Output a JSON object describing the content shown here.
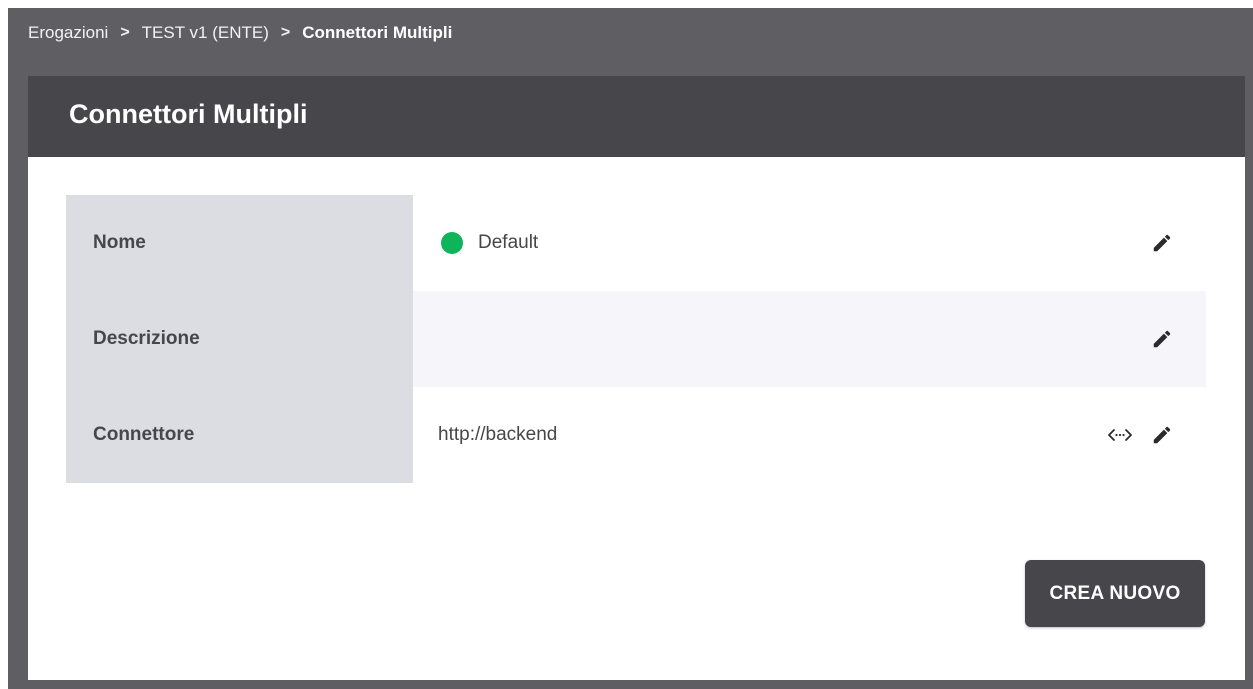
{
  "breadcrumb": {
    "items": [
      "Erogazioni",
      "TEST v1 (ENTE)"
    ],
    "current": "Connettori Multipli",
    "separator": ">"
  },
  "panel": {
    "title": "Connettori Multipli"
  },
  "rows": [
    {
      "label": "Nome",
      "value": "Default",
      "status_color": "#0db45a",
      "icons": [
        "pencil-icon"
      ]
    },
    {
      "label": "Descrizione",
      "value": "",
      "icons": [
        "pencil-icon"
      ]
    },
    {
      "label": "Connettore",
      "value": "http://backend",
      "icons": [
        "code-icon",
        "pencil-icon"
      ]
    }
  ],
  "actions": {
    "create_label": "CREA NUOVO"
  },
  "colors": {
    "frame_bg": "#5f5f63",
    "header_bg": "#46464b",
    "label_bg": "#dcdde2",
    "alt_row_bg": "#f5f5fa",
    "button_bg": "#46464b",
    "status_active": "#0db45a"
  }
}
